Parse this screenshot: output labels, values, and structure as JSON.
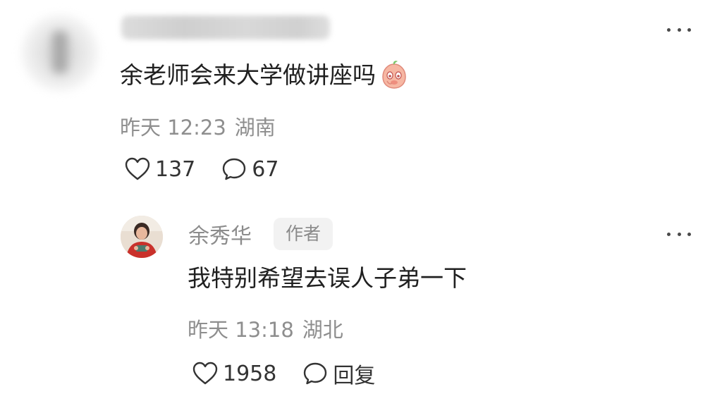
{
  "main_comment": {
    "text": "余老师会来大学做讲座吗",
    "emoji": "peach-emoji",
    "time": "昨天 12:23",
    "location": "湖南",
    "likes": "137",
    "replies": "67"
  },
  "reply_comment": {
    "username": "余秀华",
    "badge": "作者",
    "text": "我特别希望去误人子弟一下",
    "time": "昨天 13:18",
    "location": "湖北",
    "likes": "1958",
    "reply_label": "回复"
  },
  "colors": {
    "text": "#202020",
    "meta": "#8e8e8e",
    "badge_bg": "#f2f2f2"
  }
}
